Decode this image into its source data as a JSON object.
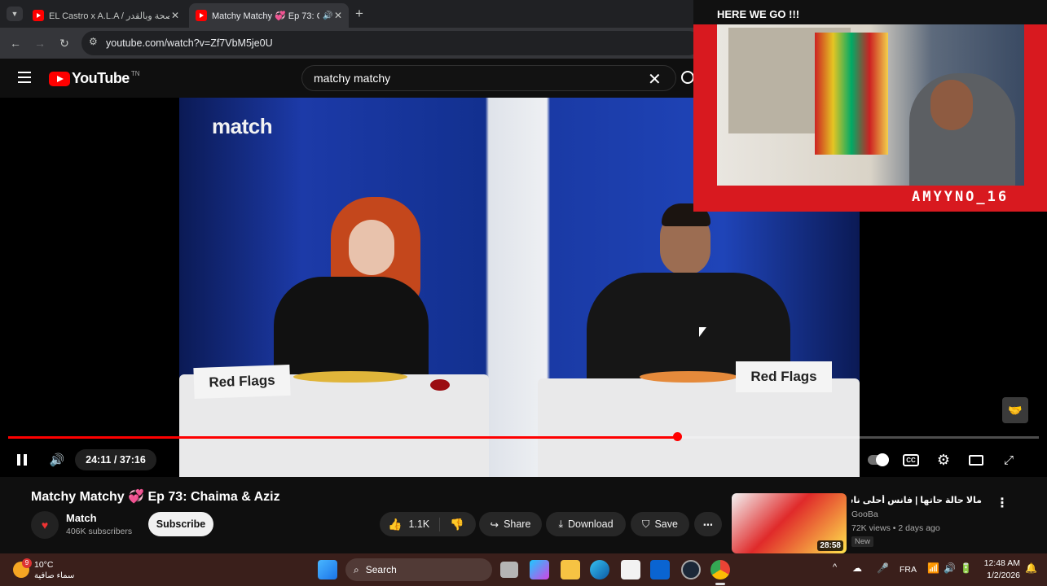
{
  "browser": {
    "tabs": [
      {
        "title": "EL Castro x A.L.A / صحة وبالقدر",
        "active": false
      },
      {
        "title": "Matchy Matchy 💞 Ep 73: C",
        "active": true
      }
    ],
    "url": "youtube.com/watch?v=Zf7VbM5je0U"
  },
  "youtube": {
    "logo_text": "YouTube",
    "logo_sup": "TN",
    "search_value": "matchy matchy"
  },
  "video": {
    "brand_overlay": "match",
    "sign_left": "Red Flags",
    "sign_right": "Red Flags",
    "time": "24:11 / 37:16",
    "progress": 0.649
  },
  "webcam": {
    "header": "HERE WE GO !!!",
    "streamer": "AMYYNO_16"
  },
  "below": {
    "title": "Matchy Matchy 💞 Ep 73: Chaima & Aziz",
    "channel": "Match",
    "subscribers": "406K subscribers",
    "subscribe": "Subscribe",
    "likes": "1.1K",
    "share": "Share",
    "download": "Download",
    "save": "Save"
  },
  "recommendation": {
    "title": "مالا حالة حاتها | فانس أحلى ناس",
    "channel": "GooBa",
    "meta": "72K views • 2 days ago",
    "badge": "New",
    "duration": "28:58"
  },
  "taskbar": {
    "temp": "10°C",
    "weather": "سماء صافية",
    "weather_badge": "9",
    "search": "Search",
    "lang": "FRA",
    "time": "12:48 AM",
    "date": "1/2/2026"
  },
  "colors": {
    "accent": "#ff0000",
    "cam_frame": "#d8191f"
  }
}
